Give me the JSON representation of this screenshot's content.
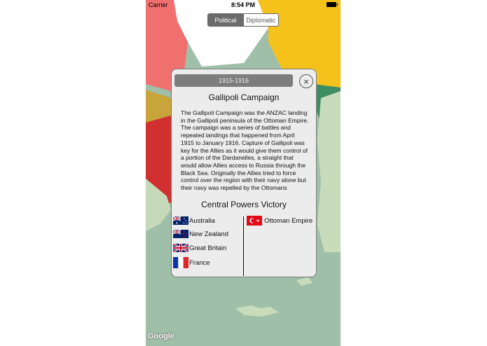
{
  "status_bar": {
    "carrier": "Carrier",
    "time": "8:54 PM"
  },
  "map_mode": {
    "political_label": "Political",
    "diplomatic_label": "Diplomatic",
    "selected": "Political"
  },
  "event_card": {
    "years": "1915-1916",
    "close_symbol": "×",
    "title": "Gallipoli Campaign",
    "description": "The Gallipoli Campaign was the ANZAC landing in the Gallipoli peninsula of the Ottoman Empire. The campaign was a series of battles and repeated landings that happened from April 1915 to January 1916. Capture of Gallipoli was key for the Allies as it would give them control of a portion of the Dardanelles, a straight that would allow Allies access to Russia through the Black Sea. Originally the Allies tried to force control over the region with their navy alone but their navy was repelled by the Ottomans",
    "result": "Central Powers Victory",
    "allies": [
      {
        "name": "Australia",
        "flag": "australia-flag"
      },
      {
        "name": "New Zealand",
        "flag": "new-zealand-flag"
      },
      {
        "name": "Great Britain",
        "flag": "uk-flag"
      },
      {
        "name": "France",
        "flag": "france-flag"
      }
    ],
    "central_powers": [
      {
        "name": "Ottoman Empire",
        "flag": "ottoman-flag"
      }
    ]
  },
  "map_attribution": "Google",
  "colors": {
    "segment_active": "#6b6b6b",
    "card_bg": "#ececec",
    "sea": "#9fbfa8"
  }
}
